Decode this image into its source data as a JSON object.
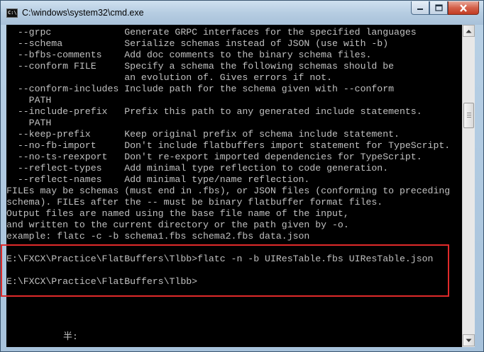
{
  "window": {
    "title": "C:\\windows\\system32\\cmd.exe",
    "icon_text": "C:\\"
  },
  "console": {
    "lines": [
      "  --grpc             Generate GRPC interfaces for the specified languages",
      "  --schema           Serialize schemas instead of JSON (use with -b)",
      "  --bfbs-comments    Add doc comments to the binary schema files.",
      "  --conform FILE     Specify a schema the following schemas should be",
      "                     an evolution of. Gives errors if not.",
      "  --conform-includes Include path for the schema given with --conform",
      "    PATH",
      "  --include-prefix   Prefix this path to any generated include statements.",
      "    PATH",
      "  --keep-prefix      Keep original prefix of schema include statement.",
      "  --no-fb-import     Don't include flatbuffers import statement for TypeScript.",
      "  --no-ts-reexport   Don't re-export imported dependencies for TypeScript.",
      "  --reflect-types    Add minimal type reflection to code generation.",
      "  --reflect-names    Add minimal type/name reflection.",
      "FILEs may be schemas (must end in .fbs), or JSON files (conforming to preceding",
      "schema). FILEs after the -- must be binary flatbuffer format files.",
      "Output files are named using the base file name of the input,",
      "and written to the current directory or the path given by -o.",
      "example: flatc -c -b schema1.fbs schema2.fbs data.json",
      "",
      "E:\\FXCX\\Practice\\FlatBuffers\\Tlbb>flatc -n -b UIResTable.fbs UIResTable.json",
      "",
      "E:\\FXCX\\Practice\\FlatBuffers\\Tlbb>"
    ],
    "ime_indicator": "半:"
  },
  "colors": {
    "console_bg": "#000000",
    "console_fg": "#c0c0c0",
    "highlight_border": "#e02a2a",
    "close_button": "#c94a32"
  },
  "icons": {
    "minimize": "minimize-icon",
    "maximize": "maximize-icon",
    "close": "close-icon",
    "scroll_up": "scroll-up-arrow-icon",
    "scroll_down": "scroll-down-arrow-icon"
  }
}
